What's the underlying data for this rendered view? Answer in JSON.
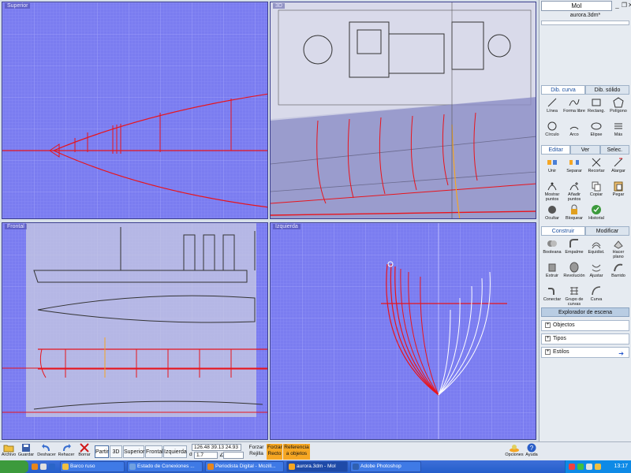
{
  "viewports": {
    "top": {
      "title": "Superior"
    },
    "perspective": {
      "title": "3D"
    },
    "front": {
      "title": "Frontal"
    },
    "left": {
      "title": "Izquierda"
    }
  },
  "app": {
    "logo": "MoI",
    "filename": "aurora.3dm*"
  },
  "draw_tabs": {
    "curve": "Dib. curva",
    "solid": "Dib. sólido"
  },
  "draw_tools": [
    "Línea",
    "Forma libre",
    "Rectang.",
    "Polígono",
    "Círculo",
    "Arco",
    "Elipse",
    "Más"
  ],
  "edit_tabs": {
    "edit": "Editar",
    "view": "Ver",
    "select": "Selec."
  },
  "edit_tools": [
    "Unir",
    "Separar",
    "Recortar",
    "Alargar",
    "Mostrar puntos",
    "Añadir puntos",
    "Copiar",
    "Pegar",
    "Ocultar",
    "Bloquear",
    "Historial"
  ],
  "build_tabs": {
    "build": "Construir",
    "modify": "Modificar"
  },
  "build_tools": [
    "Booleana",
    "Empalme",
    "Equidist.",
    "Hacer plano",
    "Extruir",
    "Revolución",
    "Ajustar",
    "Barrido",
    "Conectar",
    "Grupo de curvas",
    "Curva"
  ],
  "scene": {
    "title": "Explorador de escena",
    "items": [
      "Objectos",
      "Tipos",
      "Estilos"
    ]
  },
  "bottom": {
    "file_label": "Archivo",
    "save_label": "Guardar",
    "undo_label": "Deshacer",
    "redo_label": "Rehacer",
    "delete_label": "Borrar",
    "views": [
      "Partir",
      "3D",
      "Superior",
      "Frontal",
      "Izquierda"
    ],
    "coords": "126.48    39.13   24.93",
    "dist_prefix": "d",
    "dist_value": "1.7",
    "angle_prefix": "∠",
    "snap_grid": "Forzar Rejilla",
    "snap_straight": "Forzar Recto",
    "snap_obj": "Referencia a objetos",
    "options_label": "Opciones",
    "help_label": "Ayuda"
  },
  "taskbar": {
    "tasks": [
      "Barco ruso",
      "Estado de Conexiones ...",
      "Periodista Digital - Mozill...",
      "aurora.3dm - MoI",
      "Adobe Photoshop"
    ],
    "clock": "13:17"
  },
  "colors": {
    "viewport_bg": "#7a7cf0",
    "curve_red": "#e8141c",
    "accent_orange": "#f5a623"
  }
}
